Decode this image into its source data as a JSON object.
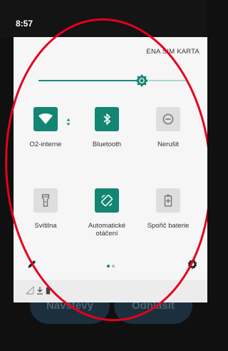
{
  "status_bar": {
    "time": "8:57"
  },
  "quick_settings": {
    "sim_text": "ENA SIM KARTA",
    "brightness": 0.74,
    "tiles": [
      {
        "label": "O2-interne",
        "icon": "wifi-icon",
        "active": true
      },
      {
        "label": "Bluetooth",
        "icon": "bluetooth-icon",
        "active": true
      },
      {
        "label": "Nerušit",
        "icon": "do-not-disturb-icon",
        "active": false
      },
      {
        "label": "Svítilna",
        "icon": "flashlight-icon",
        "active": false
      },
      {
        "label": "Automatické\notáčení",
        "icon": "auto-rotate-icon",
        "active": true
      },
      {
        "label": "Spořič baterie",
        "icon": "battery-saver-icon",
        "active": false
      }
    ],
    "page_count": 2,
    "current_page": 1
  },
  "background_buttons": [
    {
      "label": "Návštěvy"
    },
    {
      "label": "Odhlásit"
    }
  ],
  "colors": {
    "accent": "#128672",
    "annotation": "#e5001c"
  }
}
